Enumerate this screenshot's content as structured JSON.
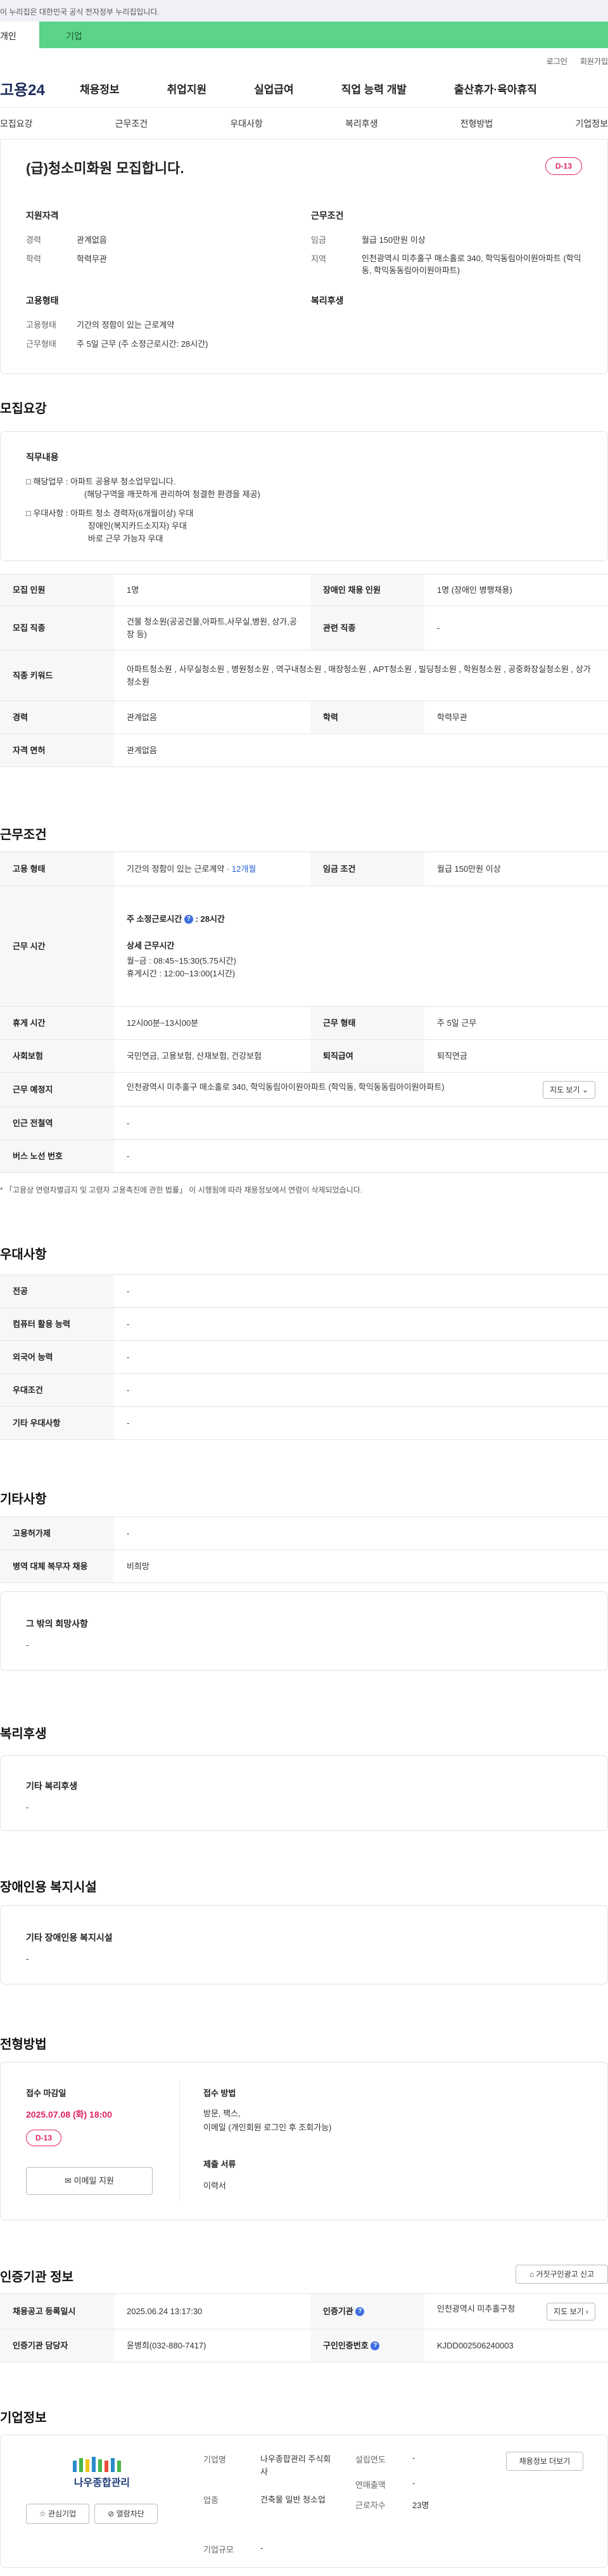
{
  "gov_banner": "이 누리집은 대한민국 공식 전자정부 누리집입니다.",
  "tabs": {
    "personal": "개인",
    "company": "기업"
  },
  "util": {
    "login": "로그인",
    "signup": "회원가입"
  },
  "logo": "고용24",
  "gnb": [
    "채용정보",
    "취업지원",
    "실업급여",
    "직업 능력 개발",
    "출산휴가·육아휴직"
  ],
  "subnav": [
    "모집요강",
    "근무조건",
    "우대사항",
    "복리후생",
    "전형방법",
    "기업정보"
  ],
  "summary": {
    "title": "(급)청소미화원 모집합니다.",
    "dday": "D-13",
    "qual_title": "지원자격",
    "career_label": "경력",
    "career_value": "관계없음",
    "edu_label": "학력",
    "edu_value": "학력무관",
    "cond_title": "근무조건",
    "wage_label": "임금",
    "wage_value": "월급 150만원 이상",
    "region_label": "지역",
    "region_value": "인천광역시 미추홀구 매소홀로 340, 학익동림아이원아파트 (학익동, 학익동동림아이원아파트)",
    "emp_title": "고용형태",
    "emptype_label": "고용형태",
    "emptype_value": "기간의 정함이 있는 근로계약",
    "worktype_label": "근무형태",
    "worktype_value": "주 5일 근무 (주 소정근로시간: 28시간)",
    "welfare_title": "복리후생"
  },
  "recruit": {
    "section_title": "모집요강",
    "duty_title": "직무내용",
    "duty_line1": "□ 해당업무 : 아파트 공용부 청소업무입니다.",
    "duty_line2": "(해당구역을 깨끗하게 관리하여 청결한 환경을 제공)",
    "duty_line3": "□ 우대사항 : 아파트 청소 경력자(6개월이상) 우대",
    "duty_line4": "장애인(복지카드소지자) 우대",
    "duty_line5": "바로 근무 가능자 우대",
    "rows": {
      "count_label": "모집 인원",
      "count_value": "1명",
      "disabled_label": "장애인 채용 인원",
      "disabled_value": "1명 (장애인 병행채용)",
      "job_label": "모집 직종",
      "job_value": "건물 청소원(공공건물,아파트,사무실,병원, 상가,공장 등)",
      "related_label": "관련 직종",
      "related_value": "-",
      "kw_label": "직종 키워드",
      "kw_value": "아파트청소원 , 사무실청소원 , 병원청소원 , 역구내청소원 , 매장청소원 , APT청소원 , 빌딩청소원 , 학원청소원 , 공중화장실청소원 , 상가청소원",
      "career_label": "경력",
      "career_value": "관계없음",
      "edu_label": "학력",
      "edu_value": "학력무관",
      "license_label": "자격 면허",
      "license_value": "관계없음"
    }
  },
  "workcond": {
    "section_title": "근무조건",
    "emptype_label": "고용 형태",
    "emptype_value": "기간의 정함이 있는 근로계약 ·",
    "emptype_months": "12개월",
    "wage_label": "임금 조건",
    "wage_value": "월급 150만원 이상",
    "hours_label": "근무 시간",
    "hours_head": "주 소정근로시간",
    "hours_head_value": ": 28시간",
    "hours_detail_title": "상세 근무시간",
    "hours_detail1": "월~금 : 08:45~15:30(5.75시간)",
    "hours_detail2": "휴게시간 : 12:00~13:00(1시간)",
    "break_label": "휴게 시간",
    "break_value": "12시00분~13시00분",
    "form_label": "근무 형태",
    "form_value": "주 5일 근무",
    "insurance_label": "사회보험",
    "insurance_value": "국민연금, 고용보험, 산재보험, 건강보험",
    "retire_label": "퇴직급여",
    "retire_value": "퇴직연금",
    "place_label": "근무 예정지",
    "place_value": "인천광역시 미추홀구 매소홀로 340, 학익동림아이원아파트 (학익동, 학익동동림아이원아파트)",
    "map_button": "지도 보기",
    "station_label": "인근 전철역",
    "station_value": "-",
    "bus_label": "버스 노선 번호",
    "bus_value": "-",
    "note": "「고용상 연령차별금지 및 고령자 고용촉진에 관한 법률」 이 시행됨에 따라 채용정보에서 연령이 삭제되었습니다."
  },
  "preference": {
    "section_title": "우대사항",
    "major_label": "전공",
    "major_value": "-",
    "pc_label": "컴퓨터 활용 능력",
    "pc_value": "-",
    "lang_label": "외국어 능력",
    "lang_value": "-",
    "cond_label": "우대조건",
    "cond_value": "-",
    "etc_label": "기타 우대사항",
    "etc_value": "-"
  },
  "other": {
    "section_title": "기타사항",
    "permit_label": "고용허가제",
    "permit_value": "-",
    "military_label": "병역 대체 복무자 채용",
    "military_value": "비희망",
    "wish_title": "그 밖의 희망사항",
    "wish_value": "-"
  },
  "welfare": {
    "section_title": "복리후생",
    "box_title": "기타 복리후생",
    "box_value": "-"
  },
  "facility": {
    "section_title": "장애인용 복지시설",
    "box_title": "기타 장애인용 복지시설",
    "box_value": "-"
  },
  "selection": {
    "section_title": "전형방법",
    "deadline_label": "접수 마감일",
    "deadline_value": "2025.07.08 (화) 18:00",
    "dday": "D-13",
    "email_button": "이메일 지원",
    "method_label": "접수 방법",
    "method_line1": "방문, 팩스,",
    "method_line2": "이메일 (개인회원 로그인 후 조회가능)",
    "docs_label": "제출 서류",
    "docs_value": "이력서"
  },
  "agency": {
    "section_title": "인증기관 정보",
    "report_button": "거짓구인광고 신고",
    "reg_label": "채용공고 등록일시",
    "reg_value": "2025.06.24 13:17:30",
    "org_label": "인증기관",
    "org_value": "인천광역시 미추홀구청",
    "map_button": "지도 보기",
    "manager_label": "인증기관 담당자",
    "manager_value": "윤병희(032-880-7417)",
    "job_no_label": "구인인증번호",
    "job_no_value": "KJDD002506240003"
  },
  "company": {
    "section_title": "기업정보",
    "logo_text": "나우종합관리",
    "fav_button": "관심기업",
    "block_button": "열람차단",
    "name_label": "기업명",
    "name_value": "나우종합관리 주식회사",
    "founded_label": "설립연도",
    "founded_value": "-",
    "sales_label": "연매출액",
    "sales_value": "-",
    "industry_label": "업종",
    "industry_value": "건축물 일반 청소업",
    "employees_label": "근로자수",
    "employees_value": "23명",
    "size_label": "기업규모",
    "size_value": "-",
    "more_button": "채용정보 더보기"
  }
}
